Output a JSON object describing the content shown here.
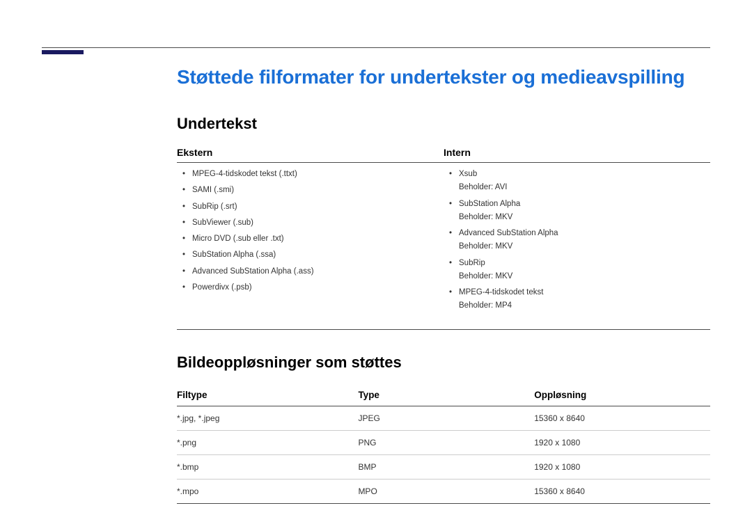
{
  "page": {
    "main_title": "Støttede filformater for undertekster og medieavspilling",
    "section_subtitle_1": "Undertekst",
    "section_subtitle_2": "Bildeoppløsninger som støttes"
  },
  "subtitle_table": {
    "cols": [
      {
        "header": "Ekstern"
      },
      {
        "header": "Intern"
      }
    ],
    "external_items": [
      {
        "label": "MPEG-4-tidskodet tekst (.ttxt)"
      },
      {
        "label": "SAMI (.smi)"
      },
      {
        "label": "SubRip (.srt)"
      },
      {
        "label": "SubViewer (.sub)"
      },
      {
        "label": "Micro DVD (.sub eller .txt)"
      },
      {
        "label": "SubStation Alpha (.ssa)"
      },
      {
        "label": "Advanced SubStation Alpha (.ass)"
      },
      {
        "label": "Powerdivx (.psb)"
      }
    ],
    "internal_items": [
      {
        "label": "Xsub",
        "container": "Beholder: AVI"
      },
      {
        "label": "SubStation Alpha",
        "container": "Beholder: MKV"
      },
      {
        "label": "Advanced SubStation Alpha",
        "container": "Beholder: MKV"
      },
      {
        "label": "SubRip",
        "container": "Beholder: MKV"
      },
      {
        "label": "MPEG-4-tidskodet tekst",
        "container": "Beholder: MP4"
      }
    ]
  },
  "resolution_table": {
    "headers": {
      "filetype": "Filtype",
      "type": "Type",
      "resolution": "Oppløsning"
    },
    "rows": [
      {
        "filetype": "*.jpg, *.jpeg",
        "type": "JPEG",
        "resolution": "15360 x 8640"
      },
      {
        "filetype": "*.png",
        "type": "PNG",
        "resolution": "1920 x 1080"
      },
      {
        "filetype": "*.bmp",
        "type": "BMP",
        "resolution": "1920 x 1080"
      },
      {
        "filetype": "*.mpo",
        "type": "MPO",
        "resolution": "15360 x 8640"
      }
    ]
  }
}
